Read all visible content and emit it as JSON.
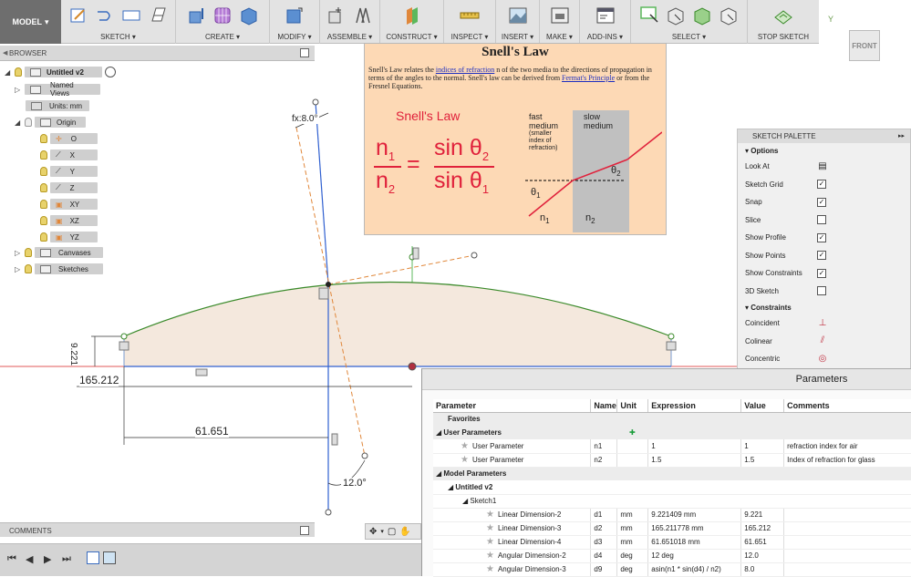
{
  "toolbar": {
    "model_label": "MODEL",
    "groups": [
      {
        "label": "SKETCH ▾"
      },
      {
        "label": "CREATE ▾"
      },
      {
        "label": "MODIFY ▾"
      },
      {
        "label": "ASSEMBLE ▾"
      },
      {
        "label": "CONSTRUCT ▾"
      },
      {
        "label": "INSPECT ▾"
      },
      {
        "label": "INSERT ▾"
      },
      {
        "label": "MAKE ▾"
      },
      {
        "label": "ADD-INS ▾"
      },
      {
        "label": "SELECT ▾"
      },
      {
        "label": "STOP SKETCH"
      }
    ]
  },
  "viewcube": {
    "label": "FRONT"
  },
  "browser": {
    "title": "BROWSER",
    "root": "Untitled v2",
    "named_views": "Named Views",
    "units": "Units: mm",
    "origin": "Origin",
    "origin_items": [
      "O",
      "X",
      "Y",
      "Z",
      "XY",
      "XZ",
      "YZ"
    ],
    "canvases": "Canvases",
    "sketches": "Sketches"
  },
  "snell": {
    "title": "Snell's Law",
    "text_1": "Snell's Law relates the ",
    "link_1": "indices of refraction",
    "text_2": " n of the two media to the directions of propagation in terms of the angles to the normal. Snell's law can be derived from ",
    "link_2": "Fermat's Principle",
    "text_3": " or from the Fresnel Equations.",
    "heading": "Snell's Law",
    "eq_n1": "n",
    "eq_sub1": "1",
    "eq_n2": "n",
    "eq_sub2": "2",
    "eq_equals": "=",
    "eq_sin": "sin θ",
    "fast_label": "fast",
    "fast_medium": "medium",
    "fast_note_1": "(smaller",
    "fast_note_2": "index of",
    "fast_note_3": "refraction)",
    "slow_label": "slow",
    "slow_medium": "medium",
    "theta1": "θ",
    "theta2": "θ",
    "n_label": "n"
  },
  "sketch": {
    "dim_angle_top": "8.0°",
    "dim_angle_top_fx": "fx:",
    "dim_height": "9.221",
    "dim_width": "165.212",
    "dim_inner": "61.651",
    "dim_angle_bottom": "12.0°"
  },
  "palette": {
    "title": "SKETCH PALETTE",
    "options_label": "Options",
    "options": [
      {
        "label": "Look At",
        "type": "icon"
      },
      {
        "label": "Sketch Grid",
        "checked": true
      },
      {
        "label": "Snap",
        "checked": true
      },
      {
        "label": "Slice",
        "checked": false
      },
      {
        "label": "Show Profile",
        "checked": true
      },
      {
        "label": "Show Points",
        "checked": true
      },
      {
        "label": "Show Constraints",
        "checked": true
      },
      {
        "label": "3D Sketch",
        "checked": false
      }
    ],
    "constraints_label": "Constraints",
    "constraints": [
      "Coincident",
      "Colinear",
      "Concentric"
    ]
  },
  "parameters": {
    "title": "Parameters",
    "columns": [
      "Parameter",
      "Name",
      "Unit",
      "Expression",
      "Value",
      "Comments"
    ],
    "favorites": "Favorites",
    "user_parameters": "User Parameters",
    "user_rows": [
      {
        "param": "User Parameter",
        "name": "n1",
        "unit": "",
        "expr": "1",
        "value": "1",
        "comment": "refraction index for air"
      },
      {
        "param": "User Parameter",
        "name": "n2",
        "unit": "",
        "expr": "1.5",
        "value": "1.5",
        "comment": "Index of refraction for glass"
      }
    ],
    "model_parameters": "Model Parameters",
    "model_root": "Untitled v2",
    "sketch_name": "Sketch1",
    "model_rows": [
      {
        "param": "Linear Dimension-2",
        "name": "d1",
        "unit": "mm",
        "expr": "9.221409 mm",
        "value": "9.221",
        "comment": ""
      },
      {
        "param": "Linear Dimension-3",
        "name": "d2",
        "unit": "mm",
        "expr": "165.211778 mm",
        "value": "165.212",
        "comment": ""
      },
      {
        "param": "Linear Dimension-4",
        "name": "d3",
        "unit": "mm",
        "expr": "61.651018 mm",
        "value": "61.651",
        "comment": ""
      },
      {
        "param": "Angular Dimension-2",
        "name": "d4",
        "unit": "deg",
        "expr": "12 deg",
        "value": "12.0",
        "comment": ""
      },
      {
        "param": "Angular Dimension-3",
        "name": "d9",
        "unit": "deg",
        "expr": "asin(n1 * sin(d4) / n2)",
        "value": "8.0",
        "comment": ""
      }
    ]
  },
  "comments": {
    "title": "COMMENTS"
  }
}
